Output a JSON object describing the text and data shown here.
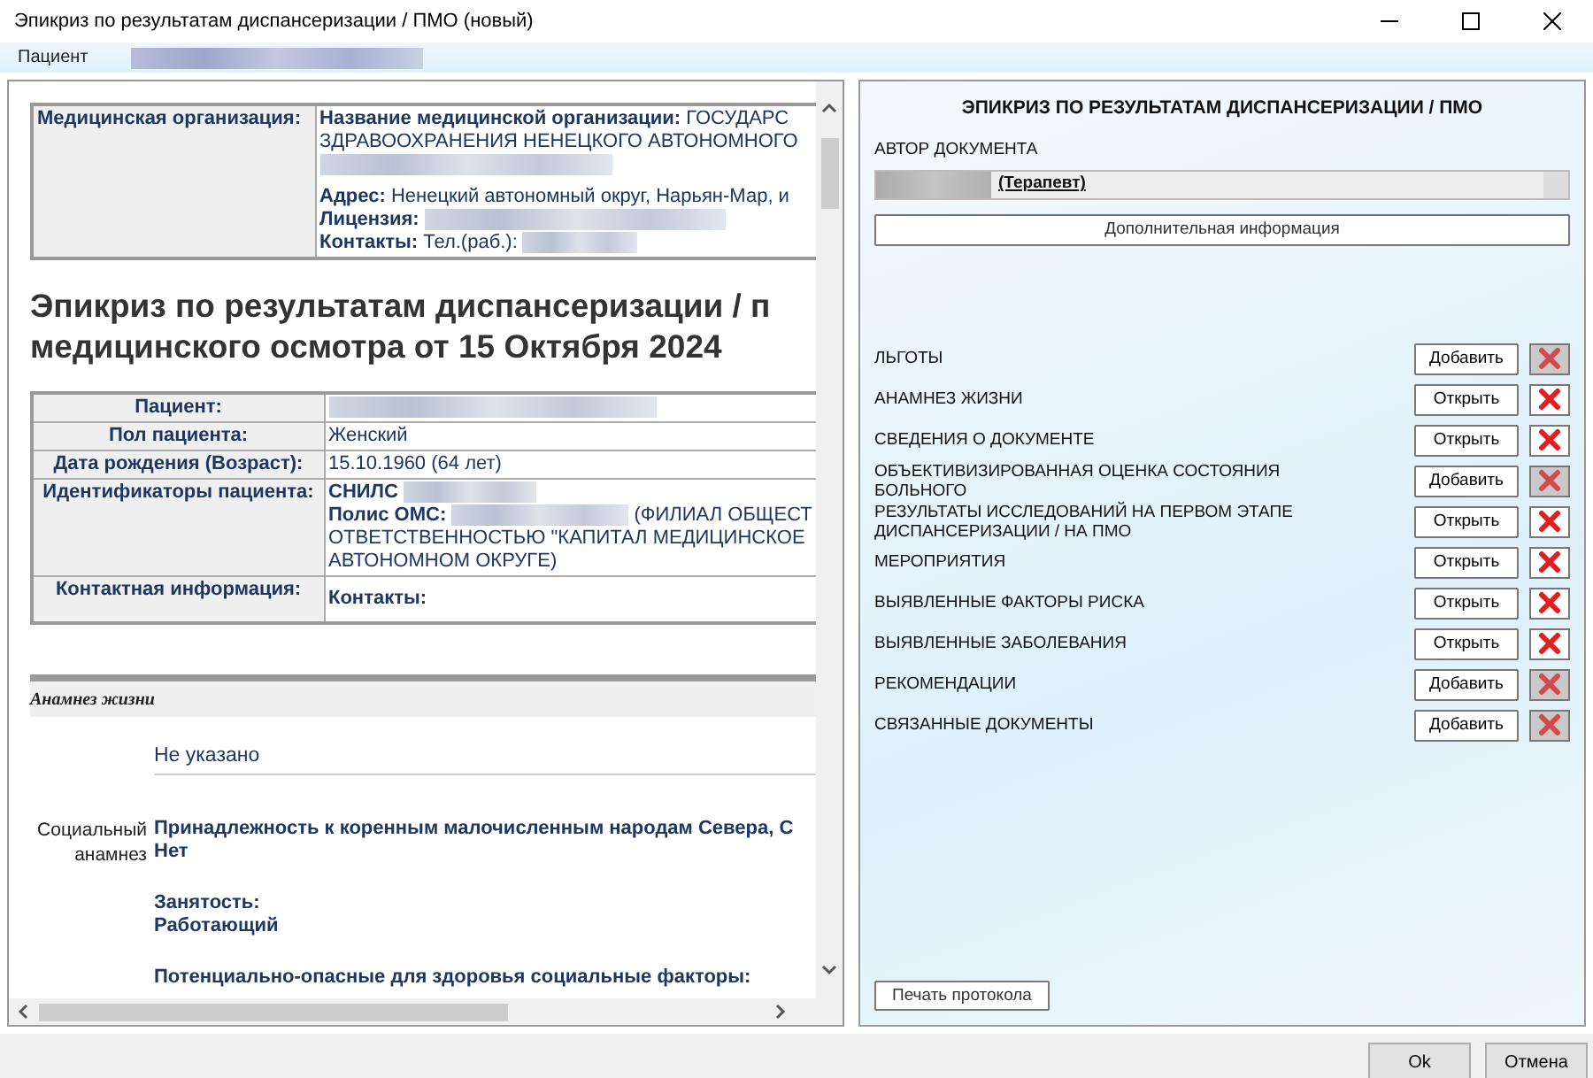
{
  "window": {
    "title": "Эпикриз по результатам диспансеризации / ПМО (новый)"
  },
  "patient_bar": {
    "label": "Пациент",
    "redacted": true
  },
  "document": {
    "org": {
      "label": "Медицинская организация:",
      "lines": [
        [
          {
            "text": "**Название медицинской организации:** ГОСУДАРС"
          }
        ],
        [
          {
            "text": "ЗДРАВООХРАНЕНИЯ НЕНЕЦКОГО АВТОНОМНОГО"
          }
        ],
        [
          {
            "kind": "redacted"
          }
        ],
        [
          {
            "kind": "gap"
          }
        ],
        [
          {
            "text": "**Адрес:** Ненецкий автономный округ, Нарьян-Мар, и"
          }
        ],
        [
          {
            "text": "**Лицензия:**"
          },
          {
            "kind": "redacted"
          }
        ],
        [
          {
            "text": "**Контакты:** Тел.(раб.):"
          },
          {
            "kind": "redacted"
          }
        ]
      ]
    },
    "heading": [
      "Эпикриз по результатам диспансеризации / п",
      "медицинского осмотра от 15 Октября 2024"
    ],
    "patient_rows": [
      {
        "label": "Пациент:",
        "lines": [
          [
            {
              "kind": "redacted"
            }
          ]
        ]
      },
      {
        "label": "Пол пациента:",
        "lines": [
          [
            {
              "text": "Женский"
            }
          ]
        ]
      },
      {
        "label": "Дата рождения (Возраст):",
        "lines": [
          [
            {
              "text": "15.10.1960 (64 лет)"
            }
          ]
        ]
      },
      {
        "label": "Идентификаторы пациента:",
        "lines": [
          [
            {
              "text": "**СНИЛС**"
            },
            {
              "kind": "redacted"
            }
          ],
          [
            {
              "text": "**Полис ОМС:**"
            },
            {
              "kind": "redacted"
            },
            {
              "text": "(ФИЛИАЛ ОБЩЕСТ"
            }
          ],
          [
            {
              "text": "ОТВЕТСТВЕННОСТЬЮ \"КАПИТАЛ МЕДИЦИНСКОЕ"
            }
          ],
          [
            {
              "text": "АВТОНОМНОМ ОКРУГЕ)"
            }
          ]
        ]
      },
      {
        "label": "Контактная информация:",
        "lines": [
          [
            {
              "kind": "gap"
            }
          ],
          [
            {
              "text": "**Контакты:**"
            }
          ],
          [
            {
              "kind": "gap"
            }
          ]
        ]
      }
    ],
    "section": {
      "title": "Анамнез жизни",
      "not_specified": "Не указано",
      "social_label": "Социальный анамнез",
      "items": [
        {
          "question": "Принадлежность к коренным малочисленным народам Севера, С",
          "answer": "Нет"
        },
        {
          "question": "Занятость:",
          "answer": "Работающий"
        },
        {
          "question": "Потенциально-опасные для здоровья социальные факторы:"
        }
      ]
    }
  },
  "panel": {
    "title": "ЭПИКРИЗ ПО РЕЗУЛЬТАТАМ ДИСПАНСЕРИЗАЦИИ / ПМО",
    "author_label": "АВТОР ДОКУМЕНТА",
    "author_value": "(Терапевт)",
    "author_redacted": true,
    "more_button": "Дополнительная информация",
    "sections": [
      {
        "label": "ЛЬГОТЫ",
        "button": "Добавить",
        "delete_disabled": true
      },
      {
        "label": "АНАМНЕЗ ЖИЗНИ",
        "button": "Открыть",
        "delete_disabled": false
      },
      {
        "label": "СВЕДЕНИЯ О ДОКУМЕНТЕ",
        "button": "Открыть",
        "delete_disabled": false
      },
      {
        "label": "ОБЪЕКТИВИЗИРОВАННАЯ ОЦЕНКА СОСТОЯНИЯ БОЛЬНОГО",
        "button": "Добавить",
        "delete_disabled": true
      },
      {
        "label": "РЕЗУЛЬТАТЫ ИССЛЕДОВАНИЙ НА ПЕРВОМ ЭТАПЕ ДИСПАНСЕРИЗАЦИИ / НА ПМО",
        "button": "Открыть",
        "delete_disabled": false
      },
      {
        "label": "МЕРОПРИЯТИЯ",
        "button": "Открыть",
        "delete_disabled": false
      },
      {
        "label": "ВЫЯВЛЕННЫЕ ФАКТОРЫ РИСКА",
        "button": "Открыть",
        "delete_disabled": false
      },
      {
        "label": "ВЫЯВЛЕННЫЕ ЗАБОЛЕВАНИЯ",
        "button": "Открыть",
        "delete_disabled": false
      },
      {
        "label": "РЕКОМЕНДАЦИИ",
        "button": "Добавить",
        "delete_disabled": true
      },
      {
        "label": "СВЯЗАННЫЕ ДОКУМЕНТЫ",
        "button": "Добавить",
        "delete_disabled": true
      }
    ],
    "print_button": "Печать протокола"
  },
  "footer": {
    "buttons": [
      "Ok",
      "Отмена"
    ]
  }
}
